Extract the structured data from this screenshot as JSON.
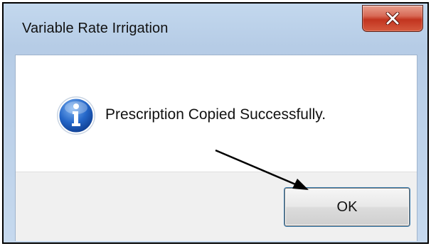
{
  "window": {
    "title": "Variable Rate Irrigation",
    "close_icon": "close-icon"
  },
  "dialog": {
    "icon": "information-icon",
    "message": "Prescription Copied Successfully.",
    "ok_label": "OK"
  },
  "annotation": {
    "icon": "arrow-annotation",
    "color": "#000000"
  },
  "colors": {
    "close_button": "#c9412a",
    "info_icon": "#1f63c6",
    "titlebar": "#c3d8ee"
  }
}
